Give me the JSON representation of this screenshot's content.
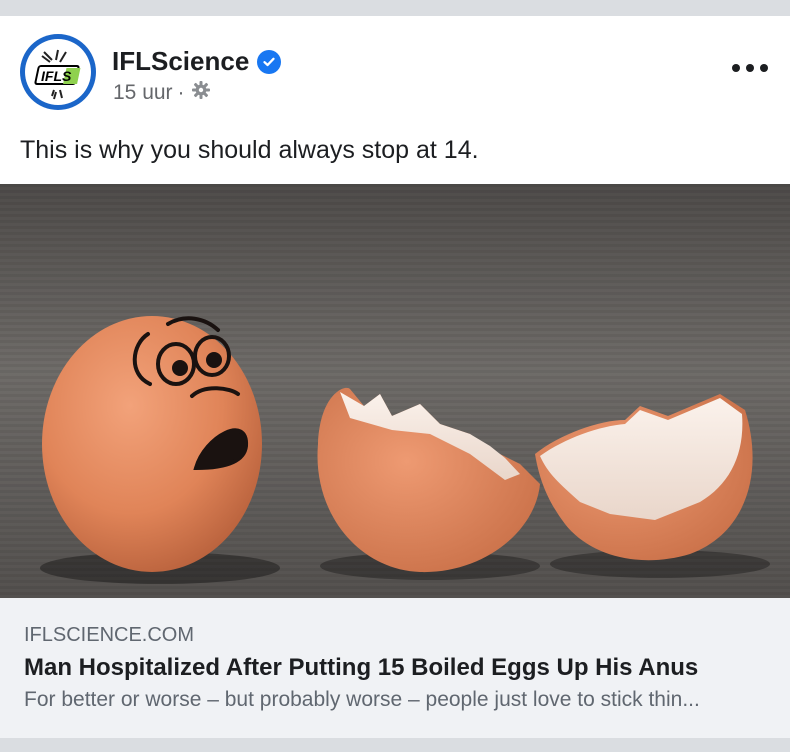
{
  "post": {
    "page_name": "IFLScience",
    "time": "15 uur",
    "separator": "·",
    "text": "This is why you should always stop at 14.",
    "icons": {
      "avatar": "iflscience-logo",
      "verified": "verified-badge-icon",
      "privacy": "gear-icon",
      "more": "more-options-icon"
    },
    "logo_text": "IFLS"
  },
  "link": {
    "domain": "IFLSCIENCE.COM",
    "title": "Man Hospitalized After Putting 15 Boiled Eggs Up His Anus",
    "description": "For better or worse – but probably worse – people just love to stick thin..."
  },
  "colors": {
    "accent": "#1877f2",
    "text_primary": "#1c1e21",
    "text_secondary": "#65676b",
    "link_bg": "#f0f2f5",
    "feed_bg": "#dadde1"
  }
}
